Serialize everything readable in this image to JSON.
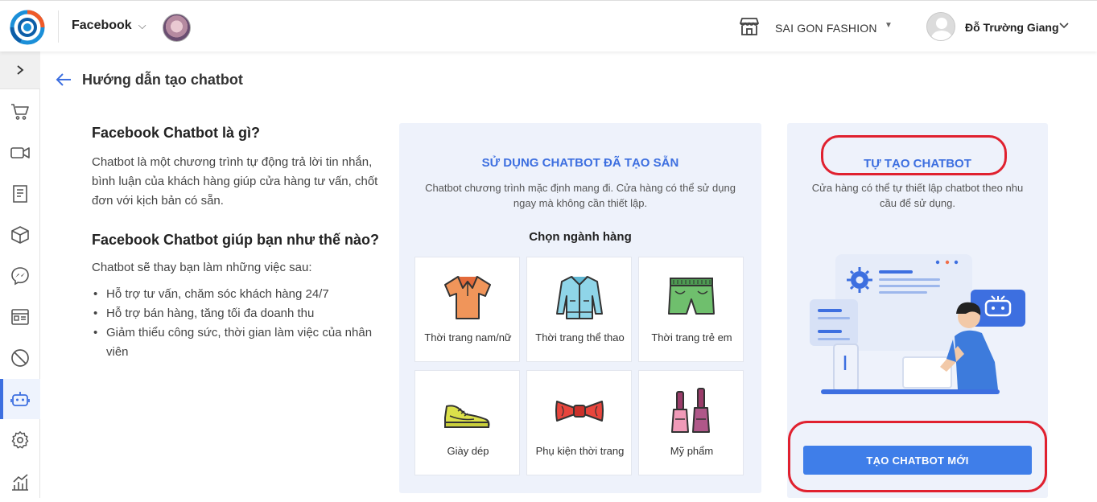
{
  "header": {
    "channel": "Facebook",
    "shop_name": "SAI GON FASHION",
    "user_name": "Đỗ Trường Giang"
  },
  "page": {
    "title": "Hướng dẫn tạo chatbot"
  },
  "intro": {
    "q1": "Facebook Chatbot là gì?",
    "a1": "Chatbot là một chương trình tự động trả lời tin nhắn, bình luận của khách hàng giúp cửa hàng tư vấn, chốt đơn với kịch bản có sẵn.",
    "q2": "Facebook Chatbot giúp bạn như thế nào?",
    "a2": "Chatbot sẽ thay bạn làm những việc sau:",
    "bullets": [
      "Hỗ trợ tư vấn, chăm sóc khách hàng 24/7",
      "Hỗ trợ bán hàng, tăng tối đa doanh thu",
      "Giảm thiểu công sức, thời gian làm việc của nhân viên"
    ]
  },
  "template_panel": {
    "title": "SỬ DỤNG CHATBOT ĐÃ TẠO SẴN",
    "desc_line1": "Chatbot chương trình mặc định mang đi. Cửa hàng có thể sử dụng",
    "desc_line2": "ngay mà không cần thiết lập.",
    "choose_label": "Chọn ngành hàng",
    "industries": [
      {
        "label": "Thời trang nam/nữ",
        "icon": "shirt-icon"
      },
      {
        "label": "Thời trang thể thao",
        "icon": "jacket-icon"
      },
      {
        "label": "Thời trang trẻ em",
        "icon": "shorts-icon"
      },
      {
        "label": "Giày dép",
        "icon": "sneaker-icon"
      },
      {
        "label": "Phụ kiện thời trang",
        "icon": "bowtie-icon"
      },
      {
        "label": "Mỹ phẩm",
        "icon": "nail-polish-icon"
      }
    ]
  },
  "custom_panel": {
    "title": "TỰ TẠO CHATBOT",
    "desc_line1": "Cửa hàng có thể tự thiết lập chatbot theo nhu",
    "desc_line2": "cầu để sử dụng.",
    "button_label": "TẠO CHATBOT MỚI"
  },
  "colors": {
    "accent": "#3d6fe0",
    "button": "#3f7ee9",
    "highlight_ring": "#e0212f",
    "panel_bg": "#eef2fb"
  }
}
